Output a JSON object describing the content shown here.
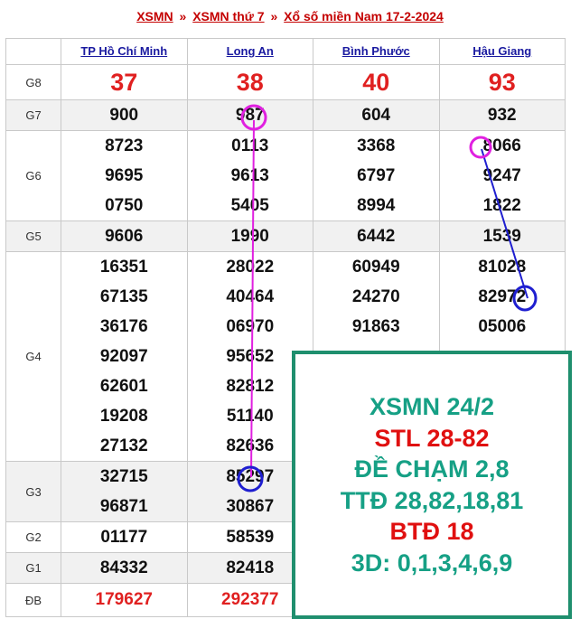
{
  "breadcrumb": {
    "root": "XSMN",
    "separator": "»",
    "day": "XSMN thứ 7",
    "title": "Xổ số miền Nam 17-2-2024"
  },
  "provinces": [
    "TP Hồ Chí Minh",
    "Long An",
    "Bình Phước",
    "Hậu Giang"
  ],
  "prizes": [
    {
      "label": "G8",
      "numbers": [
        [
          "37"
        ],
        [
          "38"
        ],
        [
          "40"
        ],
        [
          "93"
        ]
      ]
    },
    {
      "label": "G7",
      "numbers": [
        [
          "900"
        ],
        [
          "987"
        ],
        [
          "604"
        ],
        [
          "932"
        ]
      ]
    },
    {
      "label": "G6",
      "numbers": [
        [
          "8723",
          "9695",
          "0750"
        ],
        [
          "0113",
          "9613",
          "5405"
        ],
        [
          "3368",
          "6797",
          "8994"
        ],
        [
          "8066",
          "9247",
          "1822"
        ]
      ]
    },
    {
      "label": "G5",
      "numbers": [
        [
          "9606"
        ],
        [
          "1990"
        ],
        [
          "6442"
        ],
        [
          "1539"
        ]
      ]
    },
    {
      "label": "G4",
      "numbers": [
        [
          "16351",
          "67135",
          "36176",
          "92097",
          "62601",
          "19208",
          "27132"
        ],
        [
          "28022",
          "40464",
          "06970",
          "95652",
          "82812",
          "51140",
          "82636"
        ],
        [
          "60949",
          "24270",
          "91863",
          "",
          "",
          "",
          ""
        ],
        [
          "81028",
          "82972",
          "05006",
          "",
          "",
          "",
          ""
        ]
      ]
    },
    {
      "label": "G3",
      "numbers": [
        [
          "32715",
          "96871"
        ],
        [
          "85297",
          "30867"
        ],
        [
          "",
          ""
        ],
        [
          "",
          ""
        ]
      ]
    },
    {
      "label": "G2",
      "numbers": [
        [
          "01177"
        ],
        [
          "58539"
        ],
        [
          ""
        ],
        [
          ""
        ]
      ]
    },
    {
      "label": "G1",
      "numbers": [
        [
          "84332"
        ],
        [
          "82418"
        ],
        [
          ""
        ],
        [
          ""
        ]
      ]
    },
    {
      "label": "ĐB",
      "numbers": [
        [
          "179627"
        ],
        [
          "292377"
        ],
        [
          ""
        ],
        [
          ""
        ]
      ]
    }
  ],
  "prediction_box": {
    "lines": [
      {
        "text": "XSMN 24/2",
        "color": "#16a085"
      },
      {
        "text": "STL 28-82",
        "color": "#e01010"
      },
      {
        "text": "ĐỀ CHẠM 2,8",
        "color": "#16a085"
      },
      {
        "text": "TTĐ 28,82,18,81",
        "color": "#16a085"
      },
      {
        "text": "BTĐ 18",
        "color": "#e01010"
      },
      {
        "text": "3D: 0,1,3,4,6,9",
        "color": "#16a085"
      }
    ]
  },
  "annotation_colors": {
    "magenta": "#e020e0",
    "blue": "#1f1fd0"
  }
}
